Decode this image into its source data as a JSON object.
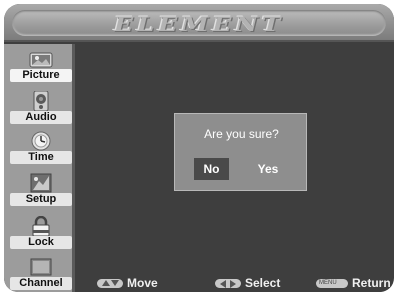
{
  "brand": {
    "logo_text": "ELEMENT"
  },
  "sidebar": {
    "items": [
      {
        "label": "Picture",
        "icon": "picture-icon"
      },
      {
        "label": "Audio",
        "icon": "audio-icon"
      },
      {
        "label": "Time",
        "icon": "clock-icon"
      },
      {
        "label": "Setup",
        "icon": "setup-icon"
      },
      {
        "label": "Lock",
        "icon": "lock-icon"
      },
      {
        "label": "Channel",
        "icon": "channel-icon"
      }
    ]
  },
  "dialog": {
    "title": "Are you sure?",
    "no_label": "No",
    "yes_label": "Yes",
    "selected": "No"
  },
  "hints": {
    "move": "Move",
    "select": "Select",
    "menu_key": "MENU",
    "return": "Return"
  }
}
